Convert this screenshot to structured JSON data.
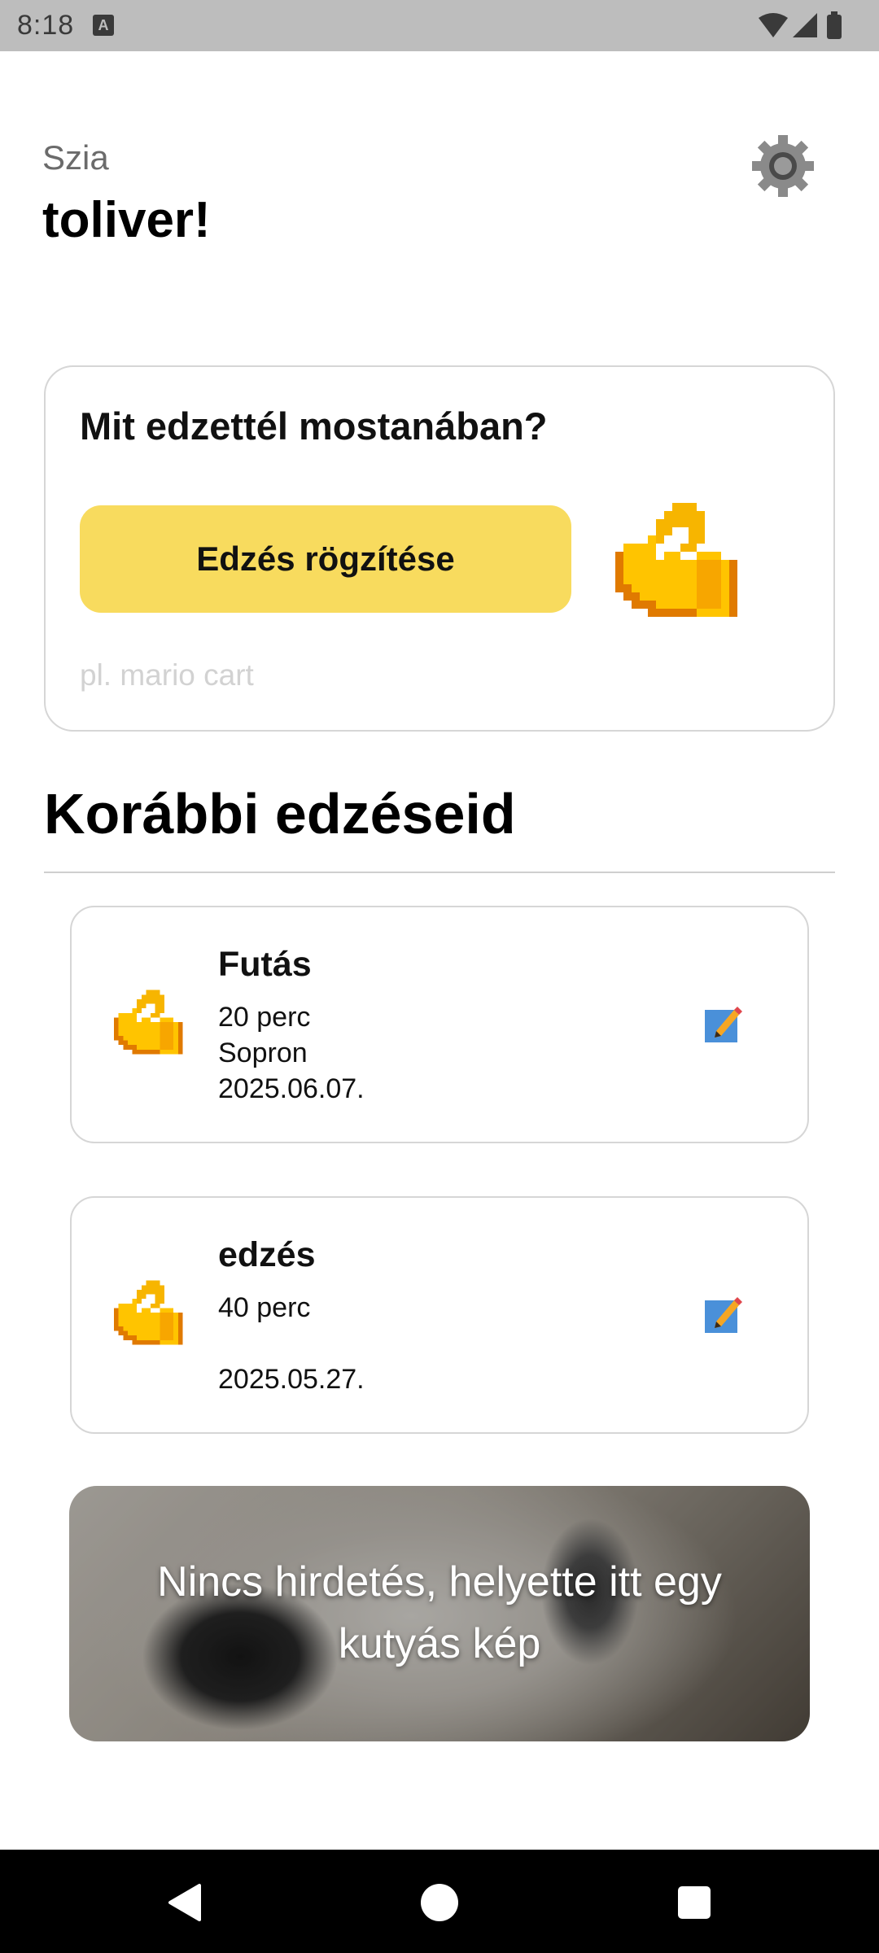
{
  "status_bar": {
    "time": "8:18",
    "notification_icon": "A"
  },
  "header": {
    "greeting": "Szia",
    "username": "toliver!",
    "settings_icon": "gear-icon"
  },
  "prompt_card": {
    "title": "Mit edzettél mostanában?",
    "record_button_label": "Edzés rögzítése",
    "input_placeholder": "pl. mario cart",
    "icon": "flexed-biceps-icon",
    "accent_color": "#f8db5e"
  },
  "history": {
    "title": "Korábbi edzéseid",
    "workouts": [
      {
        "name": "Futás",
        "duration": "20 perc",
        "location": "Sopron",
        "date": "2025.06.07."
      },
      {
        "name": "edzés",
        "duration": "40 perc",
        "location": "",
        "date": "2025.05.27."
      }
    ]
  },
  "banner": {
    "text_line1": "Nincs hirdetés, helyette itt egy",
    "text_line2": "kutyás kép"
  }
}
